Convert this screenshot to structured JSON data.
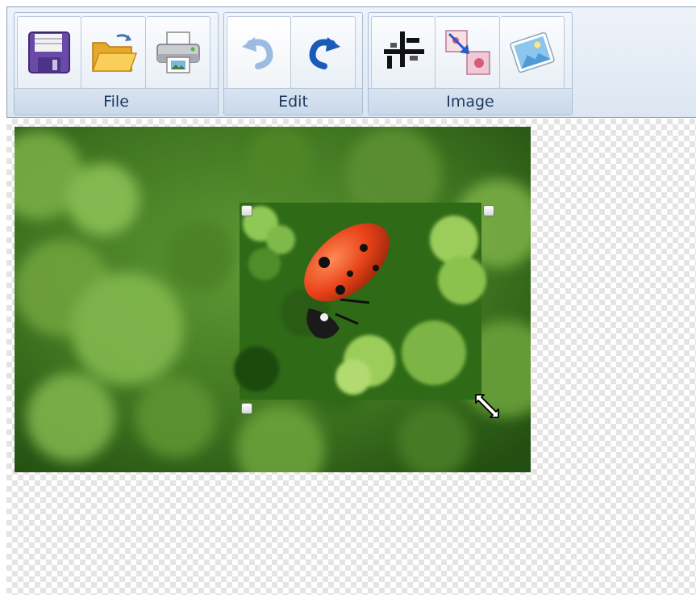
{
  "toolbar": {
    "groups": [
      {
        "label": "File",
        "buttons": [
          "save",
          "open",
          "print"
        ]
      },
      {
        "label": "Edit",
        "buttons": [
          "undo",
          "redo"
        ]
      },
      {
        "label": "Image",
        "buttons": [
          "crop",
          "resize",
          "insert-image"
        ]
      }
    ]
  },
  "colors": {
    "ribbon_label": "#1e395b",
    "ribbon_border": "#8aa0bd",
    "foliage_dark": "#244f12",
    "foliage_light": "#9ccd5a",
    "ladybug_red": "#e8431a"
  },
  "icons": [
    "save-disk-icon",
    "open-folder-icon",
    "printer-icon",
    "undo-arrow-icon",
    "redo-arrow-icon",
    "crop-icon",
    "resize-image-icon",
    "insert-picture-icon",
    "resize-cursor-icon"
  ]
}
